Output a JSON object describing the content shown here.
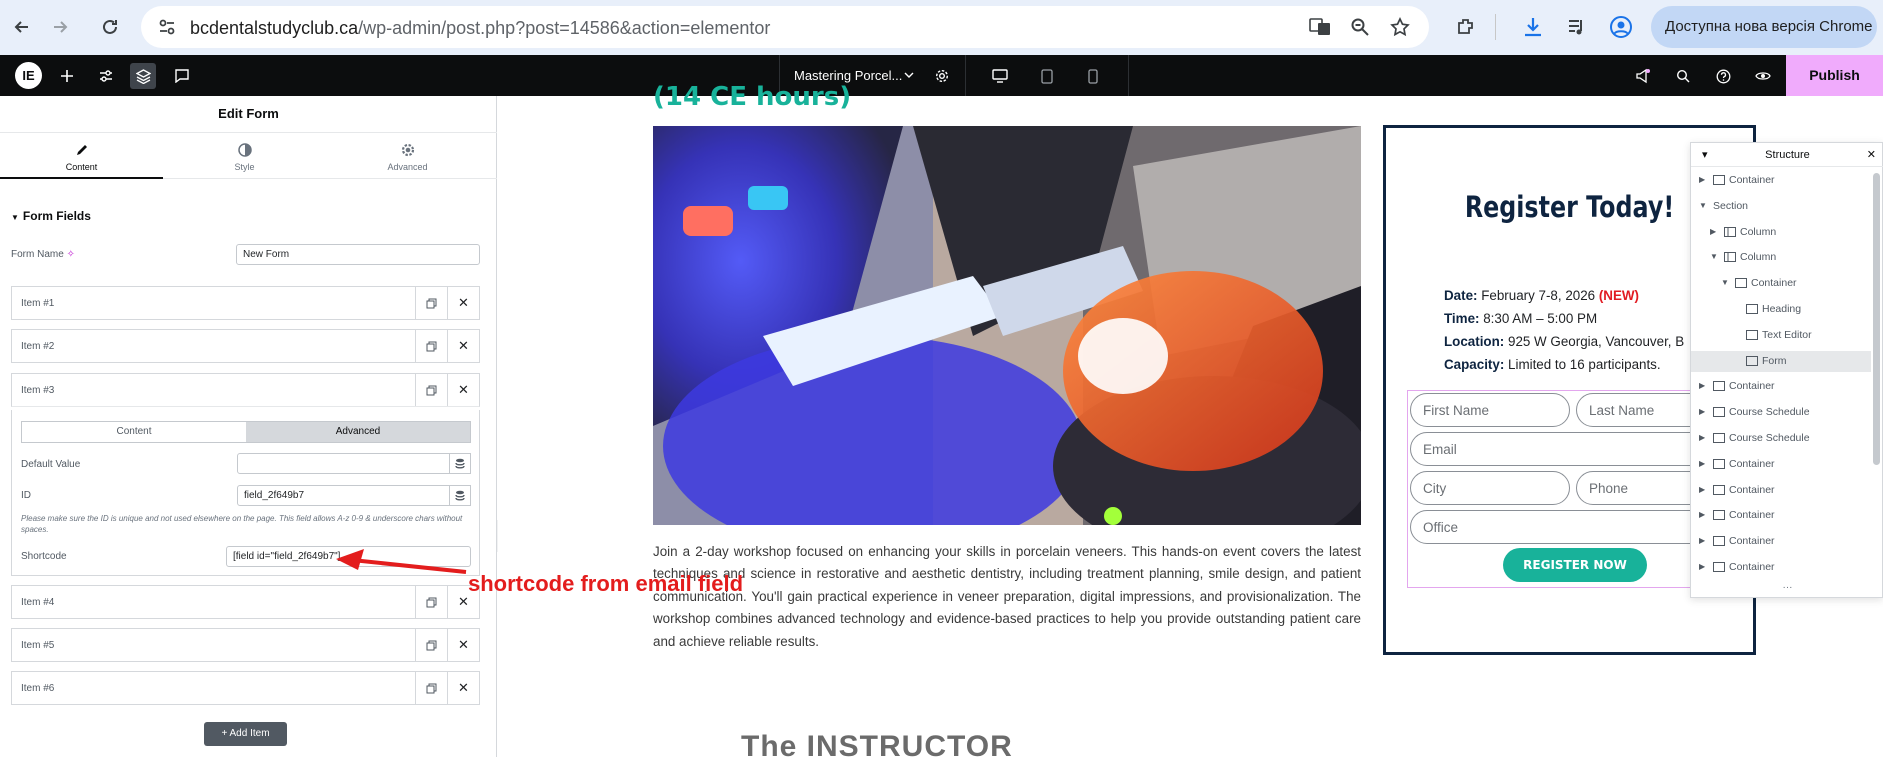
{
  "browser": {
    "url_host": "bcdentalstudyclub.ca",
    "url_path": "/wp-admin/post.php?post=14586&action=elementor",
    "update_label": "Доступна нова версія Chrome"
  },
  "topbar": {
    "page_name": "Mastering Porcel...",
    "publish_label": "Publish"
  },
  "panel": {
    "title": "Edit Form",
    "tabs": [
      {
        "label": "Content"
      },
      {
        "label": "Style"
      },
      {
        "label": "Advanced"
      }
    ],
    "section_title": "Form Fields",
    "form_name_label": "Form Name",
    "form_name_value": "New Form",
    "items": [
      {
        "label": "Item #1"
      },
      {
        "label": "Item #2"
      },
      {
        "label": "Item #3"
      },
      {
        "label": "Item #4"
      },
      {
        "label": "Item #5"
      },
      {
        "label": "Item #6"
      }
    ],
    "item_tabs": {
      "content": "Content",
      "advanced": "Advanced"
    },
    "default_value_label": "Default Value",
    "id_label": "ID",
    "id_value": "field_2f649b7",
    "id_hint": "Please make sure the ID is unique and not used elsewhere on the page. This field allows A-z 0-9 & underscore chars without spaces.",
    "shortcode_label": "Shortcode",
    "shortcode_value": "[field id=\"field_2f649b7\"]",
    "add_item_label": "Add Item"
  },
  "annotation": {
    "text": "shortcode from email field",
    "color": "#e31d1d"
  },
  "canvas": {
    "hero_cut": "(14 CE hours)",
    "description": "Join a 2-day workshop focused on enhancing your skills in porcelain veneers. This hands-on event covers the latest techniques and science in restorative and aesthetic dentistry, including treatment planning, smile design, and patient communication. You'll gain practical experience in veneer preparation, digital impressions, and provisionalization. The workshop combines advanced technology and evidence-based practices to help you provide outstanding patient care and achieve reliable results.",
    "instructor_heading": "The INSTRUCTOR",
    "register": {
      "title": "Register Today!",
      "date_label": "Date:",
      "date_value": "February 7-8, 2026",
      "date_badge": "(NEW)",
      "time_label": "Time:",
      "time_value": "8:30 AM – 5:00 PM",
      "location_label": "Location:",
      "location_value": "925 W Georgia, Vancouver, B",
      "capacity_label": "Capacity:",
      "capacity_value": "Limited to 16 participants.",
      "fields": {
        "first_name": "First Name",
        "last_name": "Last Name",
        "email": "Email",
        "city": "City",
        "phone": "Phone",
        "office": "Office"
      },
      "button_label": "REGISTER NOW"
    }
  },
  "structure": {
    "title": "Structure",
    "rows": [
      {
        "label": "Container",
        "icon": "container-icon",
        "arrow": "right"
      },
      {
        "label": "Section",
        "icon": "none",
        "arrow": "down"
      },
      {
        "label": "Column",
        "icon": "column-icon",
        "arrow": "right"
      },
      {
        "label": "Column",
        "icon": "column-icon",
        "arrow": "down"
      },
      {
        "label": "Container",
        "icon": "container-icon",
        "arrow": "down"
      },
      {
        "label": "Heading",
        "icon": "heading-icon",
        "arrow": "none"
      },
      {
        "label": "Text Editor",
        "icon": "text-editor-icon",
        "arrow": "none"
      },
      {
        "label": "Form",
        "icon": "form-icon",
        "arrow": "none"
      },
      {
        "label": "Container",
        "icon": "container-icon",
        "arrow": "right"
      },
      {
        "label": "Course Schedule",
        "icon": "container-icon",
        "arrow": "right"
      },
      {
        "label": "Course Schedule",
        "icon": "container-icon",
        "arrow": "right"
      },
      {
        "label": "Container",
        "icon": "container-icon",
        "arrow": "right"
      },
      {
        "label": "Container",
        "icon": "container-icon",
        "arrow": "right"
      },
      {
        "label": "Container",
        "icon": "container-icon",
        "arrow": "right"
      },
      {
        "label": "Container",
        "icon": "container-icon",
        "arrow": "right"
      },
      {
        "label": "Container",
        "icon": "container-icon",
        "arrow": "right"
      }
    ]
  },
  "colors": {
    "accent_teal": "#18b29a",
    "navy": "#0e2440",
    "publish_pink": "#f0abfc",
    "badge_red": "#e11b22"
  }
}
